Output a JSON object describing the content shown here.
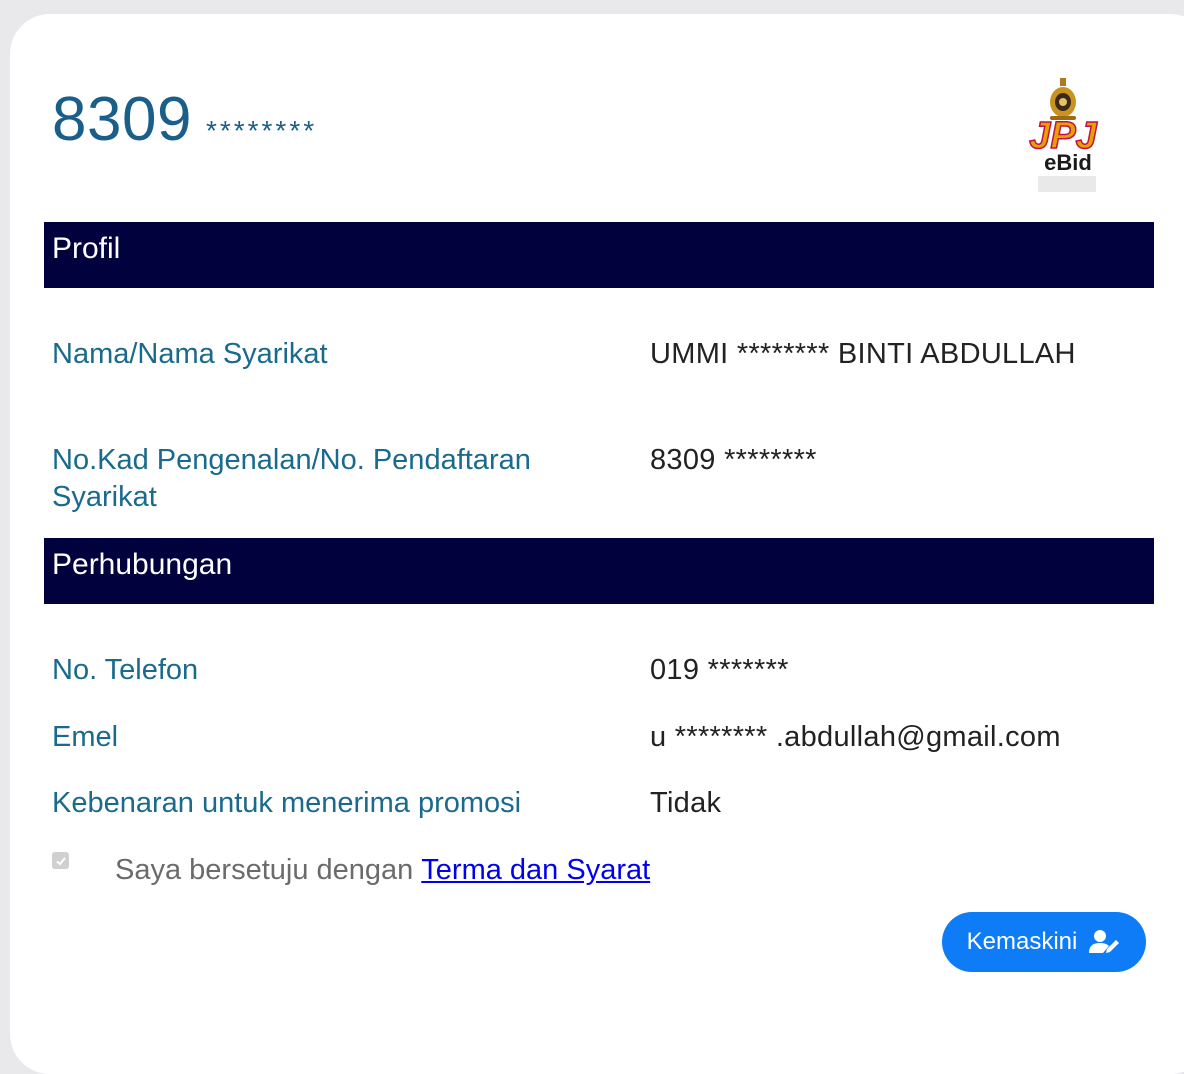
{
  "header": {
    "id_prefix": "8309",
    "id_mask": "********"
  },
  "logo": {
    "brand": "JPJ",
    "product": "eBid"
  },
  "sections": {
    "profile_title": "Profil",
    "contact_title": "Perhubungan"
  },
  "profile": {
    "name_label": "Nama/Nama Syarikat",
    "name_value": "UMMI ******** BINTI ABDULLAH",
    "id_label": "No.Kad Pengenalan/No. Pendaftaran Syarikat",
    "id_value": "8309 ********"
  },
  "contact": {
    "phone_label": "No. Telefon",
    "phone_value": "019 *******",
    "email_label": "Emel",
    "email_value": "u ******** .abdullah@gmail.com",
    "promo_label": "Kebenaran untuk menerima promosi",
    "promo_value": "Tidak"
  },
  "agreement": {
    "text": "Saya bersetuju dengan",
    "link": "Terma dan Syarat"
  },
  "actions": {
    "update_label": "Kemaskini"
  },
  "colors": {
    "section_bar": "#01013e",
    "label": "#1a6a8e",
    "button": "#0d7cf6"
  }
}
